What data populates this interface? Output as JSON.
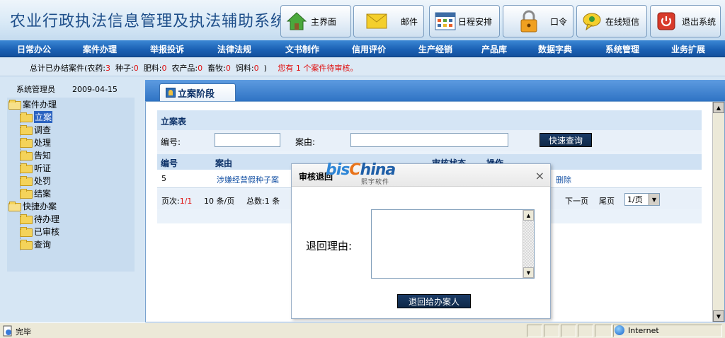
{
  "app": {
    "title": "农业行政执法信息管理及执法辅助系统"
  },
  "header_buttons": [
    {
      "label": "主界面",
      "icon": "home-icon"
    },
    {
      "label": "邮件",
      "icon": "mail-icon"
    },
    {
      "label": "日程安排",
      "icon": "calendar-icon"
    },
    {
      "label": "口令",
      "icon": "lock-icon"
    },
    {
      "label": "在线短信",
      "icon": "chat-icon"
    },
    {
      "label": "退出系统",
      "icon": "power-icon"
    }
  ],
  "nav": [
    "日常办公",
    "案件办理",
    "举报投诉",
    "法律法规",
    "文书制作",
    "信用评价",
    "生产经销",
    "产品库",
    "数据字典",
    "系统管理",
    "业务扩展"
  ],
  "stats": {
    "prefix": "总计已办结案件(农药:",
    "pesticide": "3",
    "seed_label": "种子:",
    "seed": "0",
    "fertilizer_label": "肥料:",
    "fertilizer": "0",
    "produce_label": "农产品:",
    "produce": "0",
    "livestock_label": "畜牧:",
    "livestock": "0",
    "feed_label": "饲料:",
    "feed": "0",
    "suffix": ")",
    "pending": "您有 1 个案件待审核。"
  },
  "sidebar": {
    "user": "系统管理员",
    "date": "2009-04-15",
    "groups": [
      {
        "label": "案件办理",
        "items": [
          "立案",
          "调查",
          "处理",
          "告知",
          "听证",
          "处罚",
          "结案"
        ],
        "selected": "立案"
      },
      {
        "label": "快捷办案",
        "items": [
          "待办理",
          "已审核",
          "查询"
        ]
      }
    ]
  },
  "tab": {
    "label": "立案阶段"
  },
  "panel": {
    "title": "立案表",
    "search": {
      "number_label": "编号:",
      "number_value": "",
      "case_label": "案由:",
      "case_value": "",
      "button": "快速查询"
    },
    "columns": [
      "编号",
      "案由",
      "审核状态",
      "操作"
    ],
    "rows": [
      {
        "number": "5",
        "cause": "涉嫌经营假种子案",
        "action_tail": "删除"
      }
    ],
    "pager": {
      "page_label": "页次:",
      "page_value": "1/1",
      "per_page": "10 条/页",
      "total": "总数:1 条",
      "next": "下一页",
      "last": "尾页",
      "select_value": "1/页"
    }
  },
  "modal": {
    "title": "审核退回",
    "brand_a": "bis",
    "brand_b": "C",
    "brand_c": "hina",
    "brand_sub": "熙宇软件",
    "close": "×",
    "reason_label": "退回理由:",
    "reason_value": "",
    "submit": "退回给办案人"
  },
  "status": {
    "text": "完毕",
    "zone": "Internet"
  },
  "colors": {
    "nav_blue": "#1c62b5",
    "title_blue": "#1f4f8a",
    "alert_red": "#e01010",
    "link_blue": "#1a55a6"
  }
}
